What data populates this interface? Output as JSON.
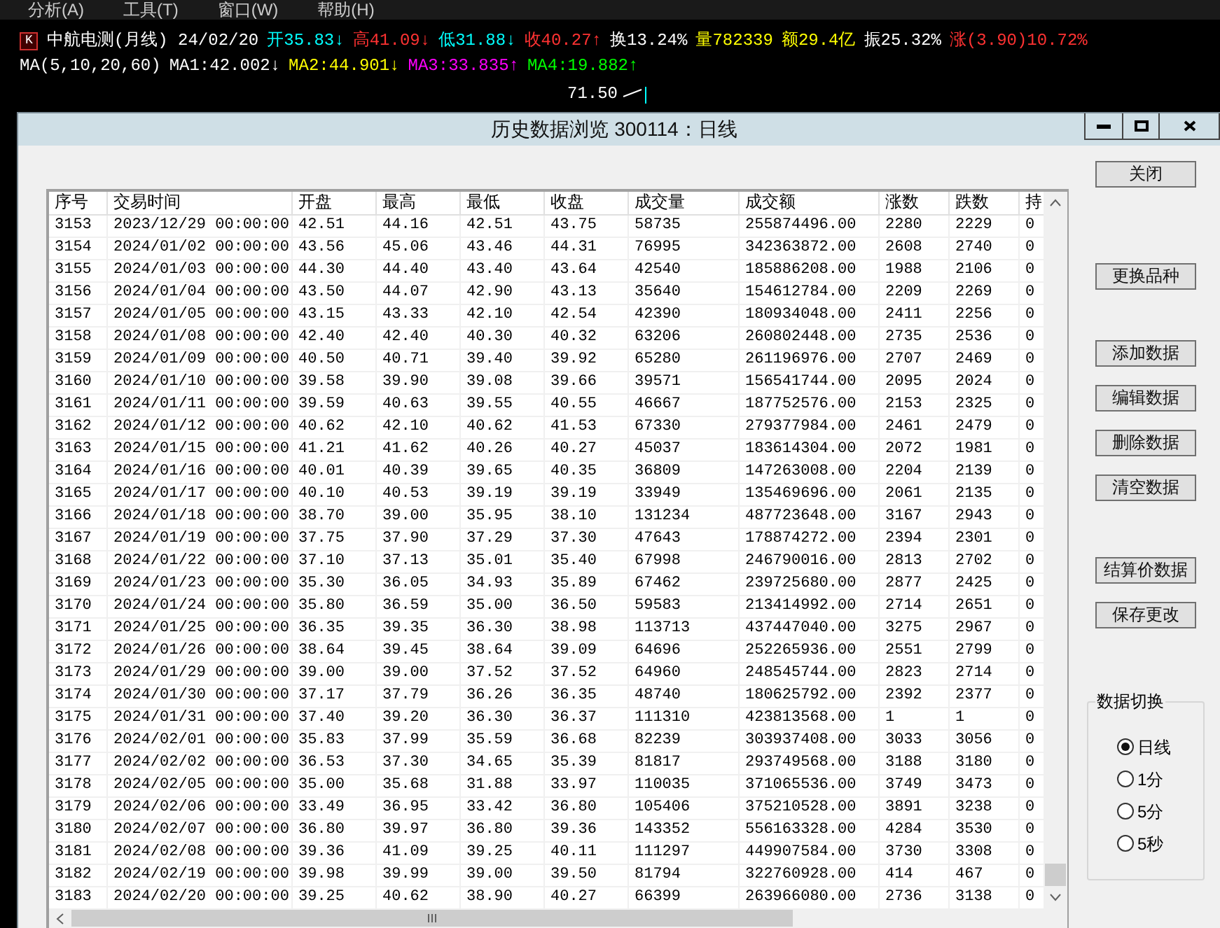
{
  "menu": [
    "分析(A)",
    "工具(T)",
    "窗口(W)",
    "帮助(H)"
  ],
  "quote": {
    "badge": "K",
    "title": "中航电测(月线) 24/02/20",
    "items": [
      {
        "text": "开35.83↓",
        "color": "#00ffff"
      },
      {
        "text": "高41.09↓",
        "color": "#ff3232"
      },
      {
        "text": "低31.88↓",
        "color": "#00ffff"
      },
      {
        "text": "收40.27↑",
        "color": "#ff3232"
      },
      {
        "text": "换13.24%",
        "color": "#ffffff"
      },
      {
        "text": "量782339",
        "color": "#ffff00"
      },
      {
        "text": "额29.4亿",
        "color": "#ffff00"
      },
      {
        "text": "振25.32%",
        "color": "#ffffff"
      },
      {
        "text": "涨(3.90)10.72%",
        "color": "#ff3232"
      }
    ],
    "ma": [
      {
        "text": "MA(5,10,20,60)",
        "color": "#ffffff"
      },
      {
        "text": "MA1:42.002↓",
        "color": "#ffffff"
      },
      {
        "text": "MA2:44.901↓",
        "color": "#ffff00"
      },
      {
        "text": "MA3:33.835↑",
        "color": "#ff00ff"
      },
      {
        "text": "MA4:19.882↑",
        "color": "#00ff00"
      }
    ],
    "price": "71.50"
  },
  "window": {
    "title": "历史数据浏览 300114：日线"
  },
  "table": {
    "columns": [
      "序号",
      "交易时间",
      "开盘",
      "最高",
      "最低",
      "收盘",
      "成交量",
      "成交额",
      "涨数",
      "跌数",
      "持"
    ],
    "rows": [
      [
        "3153",
        "2023/12/29 00:00:00",
        "42.51",
        "44.16",
        "42.51",
        "43.75",
        "58735",
        "255874496.00",
        "2280",
        "2229",
        "0"
      ],
      [
        "3154",
        "2024/01/02 00:00:00",
        "43.56",
        "45.06",
        "43.46",
        "44.31",
        "76995",
        "342363872.00",
        "2608",
        "2740",
        "0"
      ],
      [
        "3155",
        "2024/01/03 00:00:00",
        "44.30",
        "44.40",
        "43.40",
        "43.64",
        "42540",
        "185886208.00",
        "1988",
        "2106",
        "0"
      ],
      [
        "3156",
        "2024/01/04 00:00:00",
        "43.50",
        "44.07",
        "42.90",
        "43.13",
        "35640",
        "154612784.00",
        "2209",
        "2269",
        "0"
      ],
      [
        "3157",
        "2024/01/05 00:00:00",
        "43.15",
        "43.33",
        "42.10",
        "42.54",
        "42390",
        "180934048.00",
        "2411",
        "2256",
        "0"
      ],
      [
        "3158",
        "2024/01/08 00:00:00",
        "42.40",
        "42.40",
        "40.30",
        "40.32",
        "63206",
        "260802448.00",
        "2735",
        "2536",
        "0"
      ],
      [
        "3159",
        "2024/01/09 00:00:00",
        "40.50",
        "40.71",
        "39.40",
        "39.92",
        "65280",
        "261196976.00",
        "2707",
        "2469",
        "0"
      ],
      [
        "3160",
        "2024/01/10 00:00:00",
        "39.58",
        "39.90",
        "39.08",
        "39.66",
        "39571",
        "156541744.00",
        "2095",
        "2024",
        "0"
      ],
      [
        "3161",
        "2024/01/11 00:00:00",
        "39.59",
        "40.63",
        "39.55",
        "40.55",
        "46667",
        "187752576.00",
        "2153",
        "2325",
        "0"
      ],
      [
        "3162",
        "2024/01/12 00:00:00",
        "40.62",
        "42.10",
        "40.62",
        "41.53",
        "67330",
        "279377984.00",
        "2461",
        "2479",
        "0"
      ],
      [
        "3163",
        "2024/01/15 00:00:00",
        "41.21",
        "41.62",
        "40.26",
        "40.27",
        "45037",
        "183614304.00",
        "2072",
        "1981",
        "0"
      ],
      [
        "3164",
        "2024/01/16 00:00:00",
        "40.01",
        "40.39",
        "39.65",
        "40.35",
        "36809",
        "147263008.00",
        "2204",
        "2139",
        "0"
      ],
      [
        "3165",
        "2024/01/17 00:00:00",
        "40.10",
        "40.53",
        "39.19",
        "39.19",
        "33949",
        "135469696.00",
        "2061",
        "2135",
        "0"
      ],
      [
        "3166",
        "2024/01/18 00:00:00",
        "38.70",
        "39.00",
        "35.95",
        "38.10",
        "131234",
        "487723648.00",
        "3167",
        "2943",
        "0"
      ],
      [
        "3167",
        "2024/01/19 00:00:00",
        "37.75",
        "37.90",
        "37.29",
        "37.30",
        "47643",
        "178874272.00",
        "2394",
        "2301",
        "0"
      ],
      [
        "3168",
        "2024/01/22 00:00:00",
        "37.10",
        "37.13",
        "35.01",
        "35.40",
        "67998",
        "246790016.00",
        "2813",
        "2702",
        "0"
      ],
      [
        "3169",
        "2024/01/23 00:00:00",
        "35.30",
        "36.05",
        "34.93",
        "35.89",
        "67462",
        "239725680.00",
        "2877",
        "2425",
        "0"
      ],
      [
        "3170",
        "2024/01/24 00:00:00",
        "35.80",
        "36.59",
        "35.00",
        "36.50",
        "59583",
        "213414992.00",
        "2714",
        "2651",
        "0"
      ],
      [
        "3171",
        "2024/01/25 00:00:00",
        "36.35",
        "39.35",
        "36.30",
        "38.98",
        "113713",
        "437447040.00",
        "3275",
        "2967",
        "0"
      ],
      [
        "3172",
        "2024/01/26 00:00:00",
        "38.64",
        "39.45",
        "38.64",
        "39.09",
        "64696",
        "252265936.00",
        "2551",
        "2799",
        "0"
      ],
      [
        "3173",
        "2024/01/29 00:00:00",
        "39.00",
        "39.00",
        "37.52",
        "37.52",
        "64960",
        "248545744.00",
        "2823",
        "2714",
        "0"
      ],
      [
        "3174",
        "2024/01/30 00:00:00",
        "37.17",
        "37.79",
        "36.26",
        "36.35",
        "48740",
        "180625792.00",
        "2392",
        "2377",
        "0"
      ],
      [
        "3175",
        "2024/01/31 00:00:00",
        "37.40",
        "39.20",
        "36.30",
        "36.37",
        "111310",
        "423813568.00",
        "1",
        "1",
        "0"
      ],
      [
        "3176",
        "2024/02/01 00:00:00",
        "35.83",
        "37.99",
        "35.59",
        "36.68",
        "82239",
        "303937408.00",
        "3033",
        "3056",
        "0"
      ],
      [
        "3177",
        "2024/02/02 00:00:00",
        "36.53",
        "37.30",
        "34.65",
        "35.39",
        "81817",
        "293749568.00",
        "3188",
        "3180",
        "0"
      ],
      [
        "3178",
        "2024/02/05 00:00:00",
        "35.00",
        "35.68",
        "31.88",
        "33.97",
        "110035",
        "371065536.00",
        "3749",
        "3473",
        "0"
      ],
      [
        "3179",
        "2024/02/06 00:00:00",
        "33.49",
        "36.95",
        "33.42",
        "36.80",
        "105406",
        "375210528.00",
        "3891",
        "3238",
        "0"
      ],
      [
        "3180",
        "2024/02/07 00:00:00",
        "36.80",
        "39.97",
        "36.80",
        "39.36",
        "143352",
        "556163328.00",
        "4284",
        "3530",
        "0"
      ],
      [
        "3181",
        "2024/02/08 00:00:00",
        "39.36",
        "41.09",
        "39.25",
        "40.11",
        "111297",
        "449907584.00",
        "3730",
        "3308",
        "0"
      ],
      [
        "3182",
        "2024/02/19 00:00:00",
        "39.98",
        "39.99",
        "39.00",
        "39.50",
        "81794",
        "322760928.00",
        "414",
        "467",
        "0"
      ],
      [
        "3183",
        "2024/02/20 00:00:00",
        "39.25",
        "40.62",
        "38.90",
        "40.27",
        "66399",
        "263966080.00",
        "2736",
        "3138",
        "0"
      ]
    ]
  },
  "button_groups": [
    [
      "关闭"
    ],
    [
      "更换品种"
    ],
    [
      "添加数据",
      "编辑数据",
      "删除数据",
      "清空数据"
    ],
    [
      "结算价数据",
      "保存更改"
    ]
  ],
  "data_switch": {
    "title": "数据切换",
    "options": [
      {
        "label": "日线",
        "selected": true
      },
      {
        "label": "1分",
        "selected": false
      },
      {
        "label": "5分",
        "selected": false
      },
      {
        "label": "5秒",
        "selected": false
      }
    ]
  }
}
